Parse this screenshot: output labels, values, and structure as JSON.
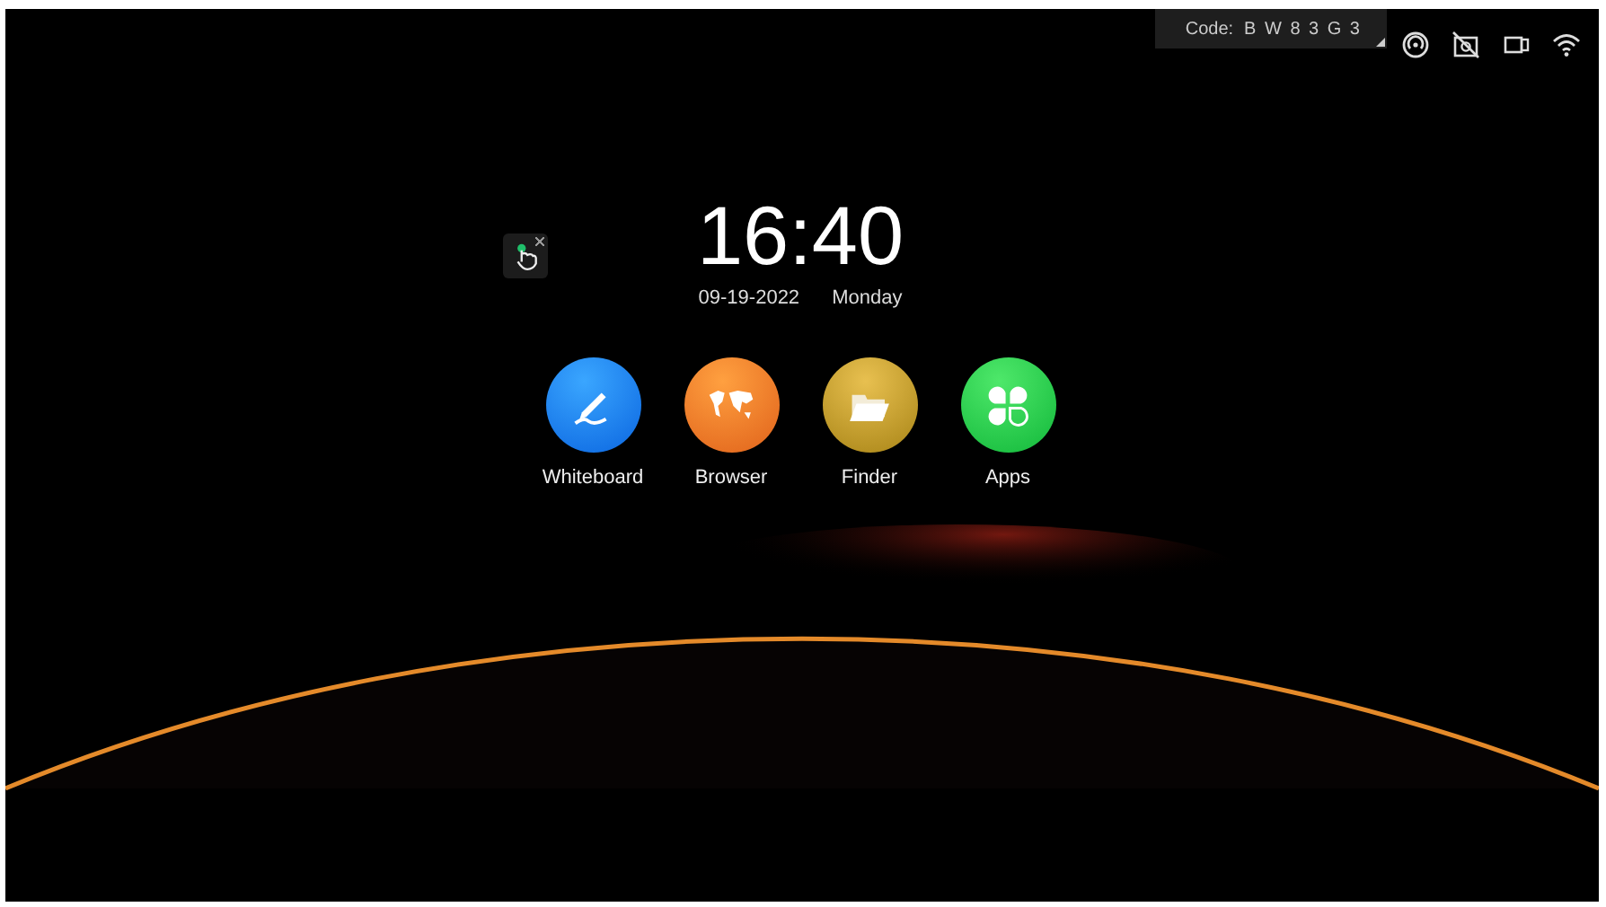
{
  "code_badge": {
    "label": "Code:",
    "value": "B W 8 3 G 3"
  },
  "clock": {
    "time": "16:40",
    "date": "09-19-2022",
    "weekday": "Monday"
  },
  "apps": [
    {
      "label": "Whiteboard",
      "kind": "pen"
    },
    {
      "label": "Browser",
      "kind": "globe"
    },
    {
      "label": "Finder",
      "kind": "folder"
    },
    {
      "label": "Apps",
      "kind": "clover"
    }
  ]
}
